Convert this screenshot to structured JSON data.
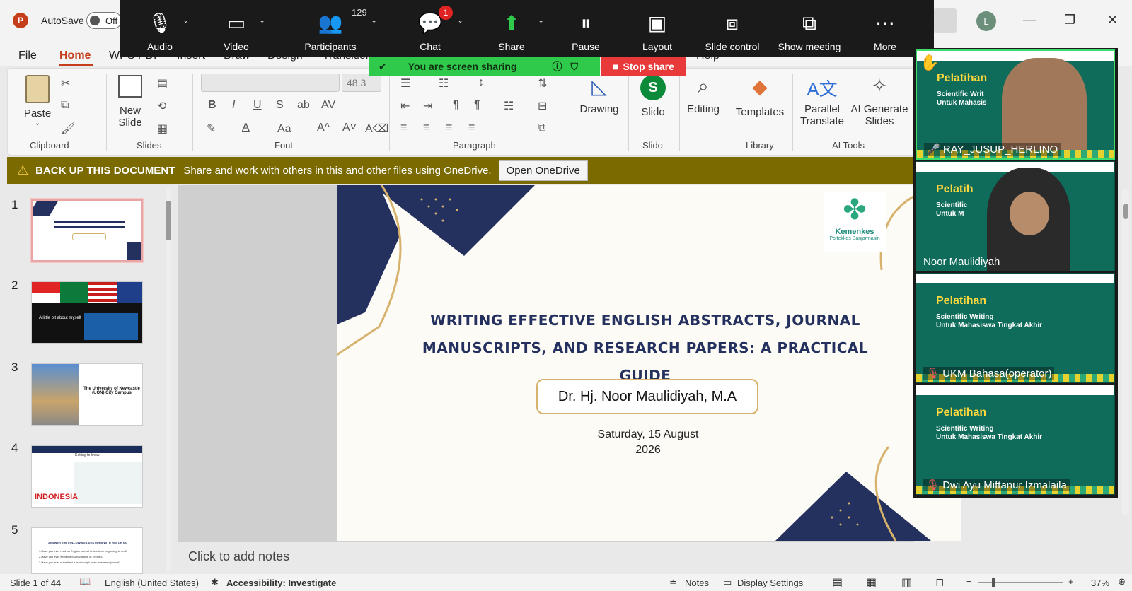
{
  "titlebar": {
    "autosave_label": "AutoSave",
    "autosave_state": "Off",
    "user_initial": "L"
  },
  "zoom": {
    "audio": "Audio",
    "video": "Video",
    "participants": "Participants",
    "participants_count": "129",
    "chat": "Chat",
    "chat_badge": "1",
    "share": "Share",
    "pause": "Pause",
    "layout": "Layout",
    "slide_control": "Slide control",
    "show_meeting": "Show meeting",
    "more": "More",
    "sharing_text": "You are screen sharing",
    "stop_share": "Stop share"
  },
  "menu": {
    "file": "File",
    "home": "Home",
    "wps": "WPS PDF",
    "insert": "Insert",
    "draw": "Draw",
    "design": "Design",
    "transitions": "Transition",
    "help": "Help"
  },
  "ribbon": {
    "paste": "Paste",
    "new_slide_1": "New",
    "new_slide_2": "Slide",
    "font_size": "48.3",
    "drawing": "Drawing",
    "slido": "Slido",
    "editing": "Editing",
    "templates": "Templates",
    "parallel_1": "Parallel",
    "parallel_2": "Translate",
    "ai_1": "AI Generate",
    "ai_2": "Slides",
    "groups": {
      "clipboard": "Clipboard",
      "slides": "Slides",
      "font": "Font",
      "paragraph": "Paragraph",
      "slido": "Slido",
      "library": "Library",
      "ai_tools": "AI Tools"
    }
  },
  "notification": {
    "title": "BACK UP THIS DOCUMENT",
    "message": "Share and work with others in this and other files using OneDrive.",
    "button": "Open OneDrive"
  },
  "thumbnails": {
    "numbers": [
      "1",
      "2",
      "3",
      "4",
      "5"
    ],
    "t2_text": "A little bit about myself",
    "t3_text": "The University of Newcastle (UON) City Campus",
    "t4_title": "Getting to know",
    "t4_word": "INDONESIA",
    "t5_title": "ANSWER THE FOLLOWING QUESTIONS WITH YES OR NO",
    "t5_q1": "1.Have you ever read an English journal article from beginning to end?",
    "t5_q2": "2.Have you ever written a journal article in English?",
    "t5_q3": "3.Have you ever submitted a manuscript to an academic journal?"
  },
  "slide": {
    "title_line1": "WRITING EFFECTIVE ENGLISH ABSTRACTS,  JOURNAL",
    "title_line2": "MANUSCRIPTS, AND RESEARCH PAPERS: A PRACTICAL GUIDE",
    "author": "Dr. Hj. Noor Maulidiyah, M.A",
    "date_line1": "Saturday, 15 August",
    "date_line2": "2026",
    "logo_name": "Kemenkes",
    "logo_sub": "Poltekkes Banjarmasin"
  },
  "notes_placeholder": "Click to add notes",
  "status": {
    "slide_info": "Slide 1 of 44",
    "language": "English (United States)",
    "accessibility": "Accessibility: Investigate",
    "notes": "Notes",
    "display_settings": "Display Settings",
    "zoom": "37%"
  },
  "participants": [
    {
      "name": "RAY_JUSUP_HERLINO",
      "title": "Pelatihan",
      "sub1": "Scientific Writ",
      "sub2": "Untuk Mahasis"
    },
    {
      "name": "Noor Maulidiyah",
      "title": "Pelatih",
      "sub1": "Scientific",
      "sub2": "Untuk M"
    },
    {
      "name": "UKM Bahasa(operator)",
      "title": "Pelatihan",
      "sub1": "Scientific Writing",
      "sub2": "Untuk Mahasiswa Tingkat Akhir"
    },
    {
      "name": "Dwi Ayu Miftanur Izmalaila",
      "title": "Pelatihan",
      "sub1": "Scientific Writing",
      "sub2": "Untuk Mahasiswa Tingkat Akhir"
    }
  ],
  "colors": {
    "accent": "#c43e1c",
    "zoom_bar": "#1a1a1a",
    "share_green": "#2fc94c",
    "stop_red": "#e83a3a",
    "notif_bg": "#7a6a00",
    "slide_navy": "#24305e",
    "slide_gold": "#d6b26c",
    "tile_green": "#0f6b5a"
  }
}
